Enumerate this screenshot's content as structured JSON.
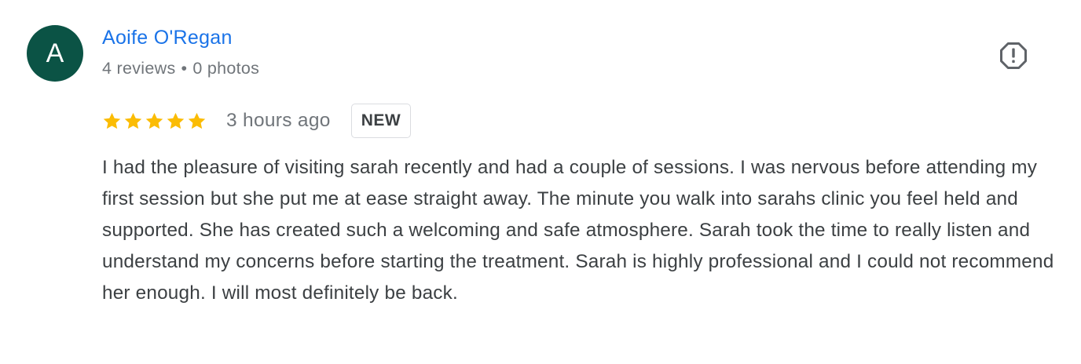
{
  "author": {
    "initial": "A",
    "name": "Aoife O'Regan",
    "reviews": "4 reviews",
    "separator": "•",
    "photos": "0 photos",
    "avatar_color": "#0b5345"
  },
  "review": {
    "rating": 5,
    "max_rating": 5,
    "time": "3 hours ago",
    "badge": "NEW",
    "text": "I had the pleasure of visiting sarah recently and had a couple of sessions. I was nervous before attending my first session but she put me at ease straight away. The minute you walk into sarahs clinic you feel held and supported. She has created such a welcoming and safe atmosphere. Sarah took the time to really listen and understand my concerns before starting the treatment. Sarah is highly professional and I could not recommend her enough. I will most definitely be back.",
    "star_color": "#fbbc04"
  },
  "actions": {
    "report_icon": "report-octagon-icon"
  },
  "colors": {
    "link": "#1a73e8",
    "secondary_text": "#70757a",
    "body_text": "#3c4043"
  }
}
